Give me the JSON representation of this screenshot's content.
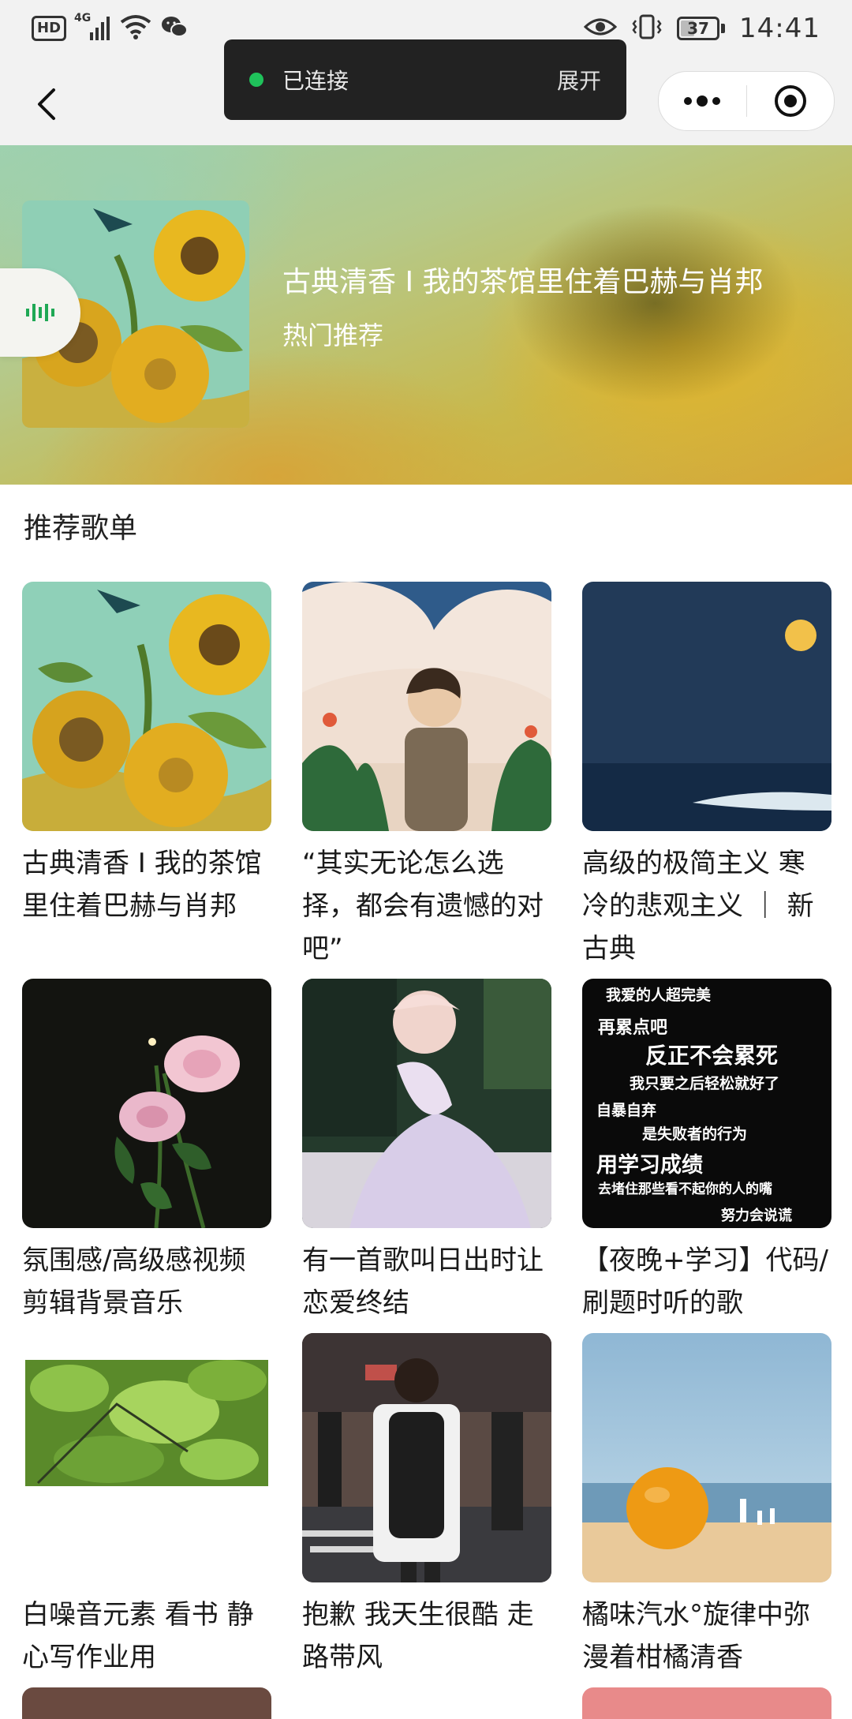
{
  "status_bar": {
    "hd": "HD",
    "network": "4G",
    "battery": "37",
    "time": "14:41"
  },
  "toast": {
    "status": "已连接",
    "expand": "展开"
  },
  "hero": {
    "title": "古典清香 I 我的茶馆里住着巴赫与肖邦",
    "subtitle": "热门推荐"
  },
  "section": {
    "title": "推荐歌单"
  },
  "playlists": [
    {
      "title": "古典清香 I 我的茶馆里住着巴赫与肖邦",
      "cover": "sunflowers"
    },
    {
      "title": "“其实无论怎么选择，都会有遗憾的对吧”",
      "cover": "boy-clouds"
    },
    {
      "title": "高级的极简主义 寒冷的悲观主义 ｜ 新古典",
      "cover": "moon-sea"
    },
    {
      "title": "氛围感/高级感视频剪辑背景音乐",
      "cover": "pink-roses"
    },
    {
      "title": "有一首歌叫日出时让恋爱终结",
      "cover": "dancer"
    },
    {
      "title": "【夜晚+学习】代码/刷题时听的歌",
      "cover": "text-poster"
    },
    {
      "title": "白噪音元素 看书 静心写作业用",
      "cover": "leaves"
    },
    {
      "title": "抱歉 我天生很酷 走路带风",
      "cover": "street"
    },
    {
      "title": "橘味汽水°旋律中弥漫着柑橘清香",
      "cover": "orange-beach"
    }
  ],
  "poster_text": [
    "我爱的人超完美",
    "再累点吧",
    "反正不会累死",
    "我只要之后轻松就好了",
    "自暴自弃",
    "是失败者的行为",
    "用学习成绩",
    "去堵住那些看不起你的人的嘴",
    "努力会说谎"
  ],
  "colors": {
    "toast_bg": "#222222",
    "connected_dot": "#1fc25b",
    "status_bg": "#f2f2f2"
  }
}
